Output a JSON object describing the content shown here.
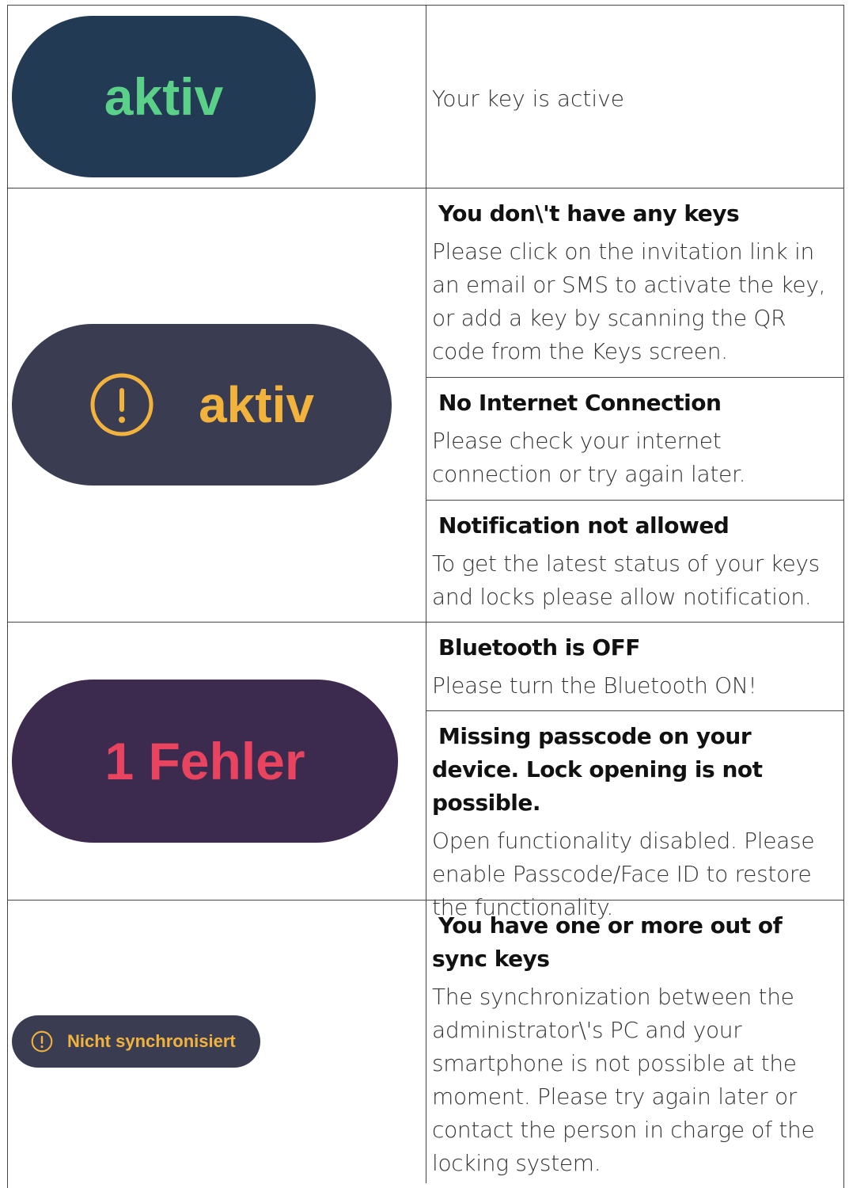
{
  "rows": [
    {
      "badge": {
        "text": "aktiv",
        "bg": "#233a55",
        "fg": "#5bd088"
      },
      "messages": [
        {
          "title": "",
          "body": "Your key is active"
        }
      ]
    },
    {
      "badge": {
        "text": "aktiv",
        "bg": "#3a3d52",
        "fg": "#f2b33d",
        "icon": "warning-circle-icon"
      },
      "messages": [
        {
          "title": "You don\\'t have any keys",
          "body": "Please click on the invitation link in an email or SMS to activate the key, or add a key by scanning the QR code from the Keys screen."
        },
        {
          "title": "No Internet Connection",
          "body": "Please check your internet connection or try again later."
        },
        {
          "title": "Notification not allowed",
          "body": "To get the latest status of your keys and locks please allow notification."
        }
      ]
    },
    {
      "badge": {
        "text": "1 Fehler",
        "bg": "#3d2b4f",
        "fg": "#e8435f"
      },
      "messages": [
        {
          "title": "Bluetooth is OFF",
          "body": "Please turn the Bluetooth ON!"
        },
        {
          "title": "Missing passcode on your device. Lock opening is not possible.",
          "body": "Open functionality disabled. Please enable Passcode/Face ID to restore the functionality."
        }
      ]
    },
    {
      "badge": {
        "text": "Nicht synchronisiert",
        "bg": "#3a3d52",
        "fg": "#f2b33d",
        "icon": "warning-circle-icon"
      },
      "messages": [
        {
          "title": "You have one or more out of sync keys",
          "body": "The synchronization between the administrator\\'s PC and your smartphone is not possible at the moment. Please try again later or contact the person in charge of the locking system."
        }
      ]
    }
  ]
}
